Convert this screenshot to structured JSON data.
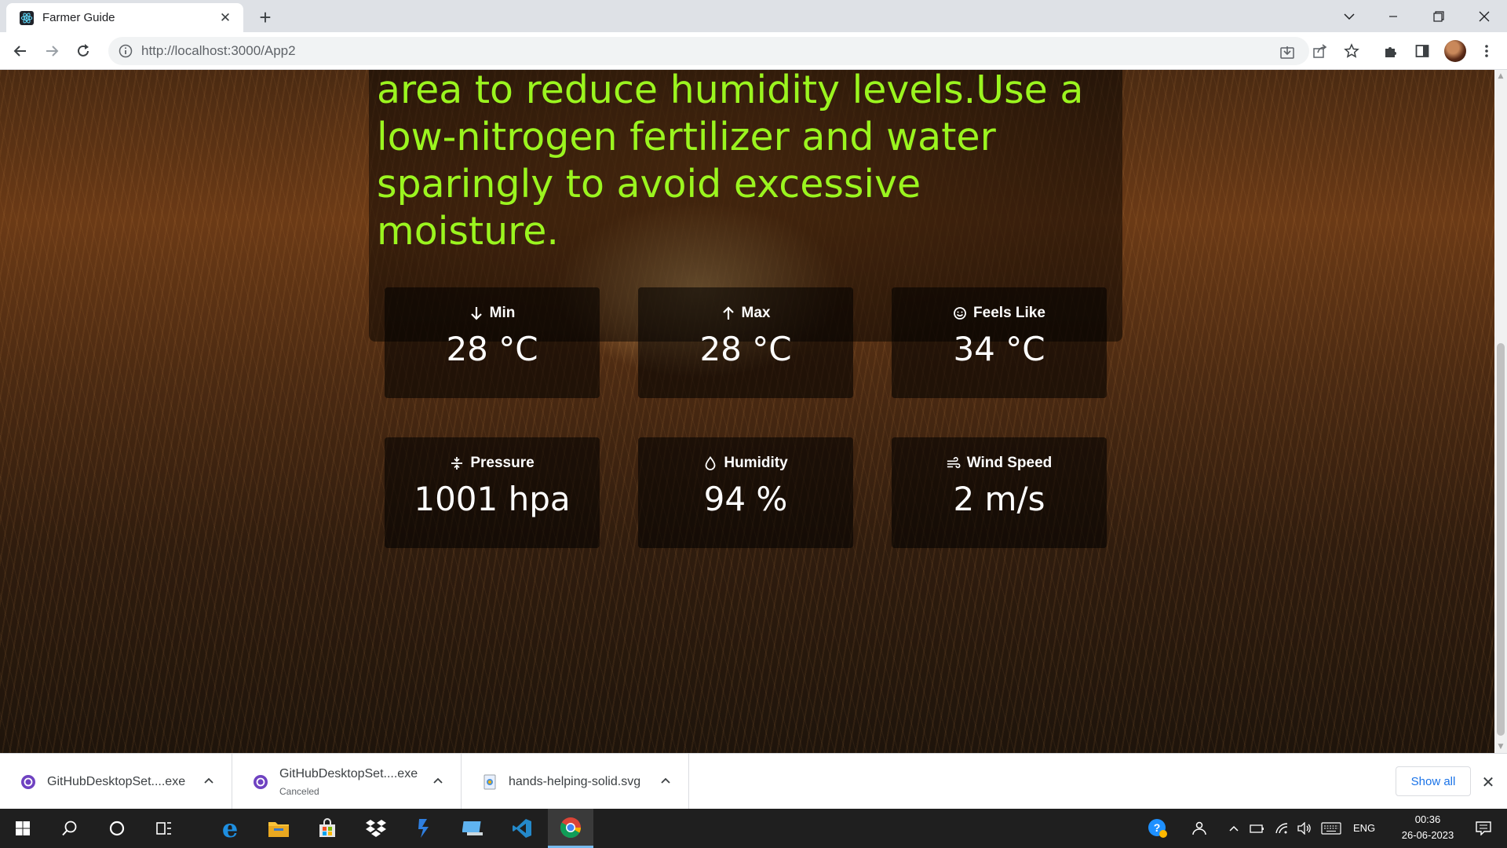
{
  "browser": {
    "tab_title": "Farmer Guide",
    "url": "http://localhost:3000/App2"
  },
  "advice": {
    "text": "area to reduce humidity levels.Use a low-nitrogen fertilizer and water sparingly to avoid excessive moisture."
  },
  "weather": {
    "min": {
      "label": "Min",
      "value": "28 °C"
    },
    "max": {
      "label": "Max",
      "value": "28 °C"
    },
    "feels_like": {
      "label": "Feels Like",
      "value": "34 °C"
    },
    "pressure": {
      "label": "Pressure",
      "value": "1001 hpa"
    },
    "humidity": {
      "label": "Humidity",
      "value": "94 %"
    },
    "wind_speed": {
      "label": "Wind Speed",
      "value": "2 m/s"
    }
  },
  "downloads": {
    "items": [
      {
        "name": "GitHubDesktopSet....exe",
        "status": ""
      },
      {
        "name": "GitHubDesktopSet....exe",
        "status": "Canceled"
      },
      {
        "name": "hands-helping-solid.svg",
        "status": ""
      }
    ],
    "show_all_label": "Show all"
  },
  "taskbar": {
    "language": "ENG",
    "time": "00:36",
    "date": "26-06-2023"
  },
  "colors": {
    "advice_text": "#9bf51f",
    "card_background": "rgba(0,0,0,0.56)",
    "link_blue": "#1a73e8",
    "taskbar": "#1f1f1f"
  }
}
